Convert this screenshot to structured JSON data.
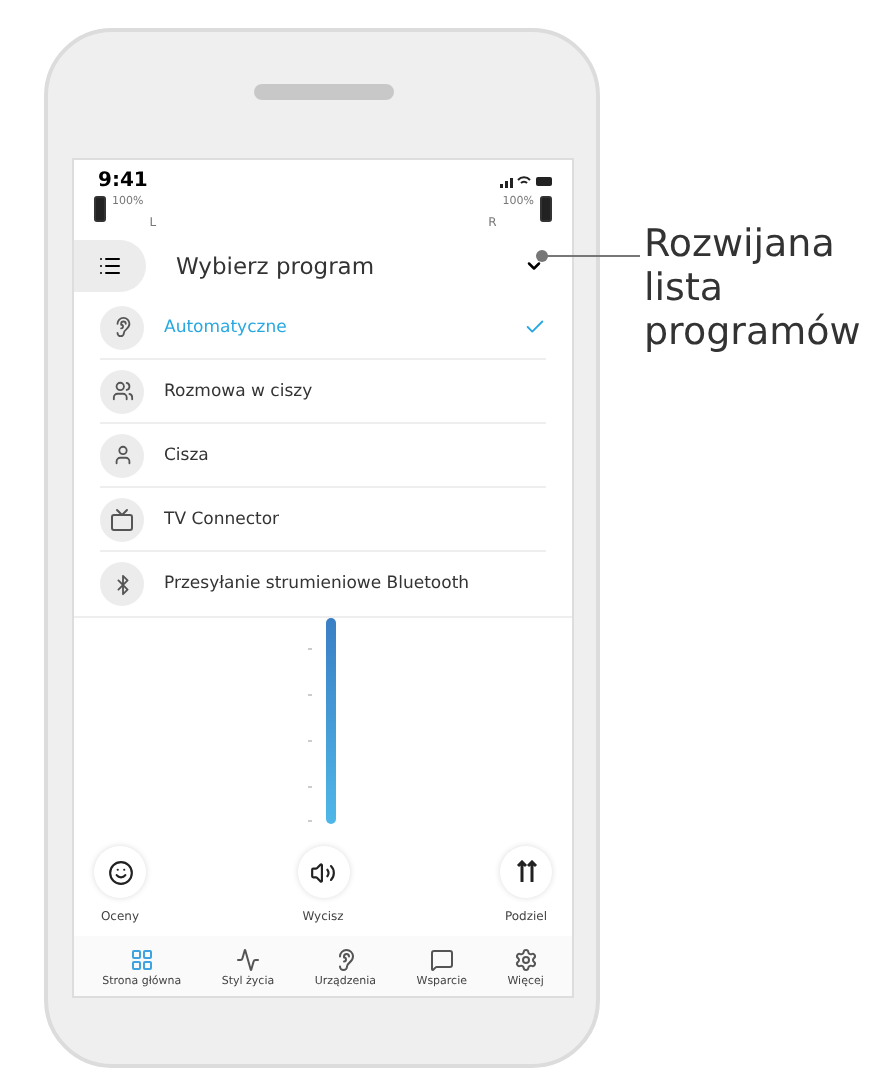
{
  "status_bar": {
    "time": "9:41"
  },
  "batteries": [
    {
      "percent": "100%",
      "side": "L"
    },
    {
      "percent": "100%",
      "side": "R"
    }
  ],
  "dropdown": {
    "title": "Wybierz program",
    "expanded": true,
    "items": [
      {
        "kind": "auto",
        "label": "Automatyczne",
        "selected": true
      },
      {
        "kind": "conversation",
        "label": "Rozmowa w ciszy",
        "selected": false
      },
      {
        "kind": "quiet",
        "label": "Cisza",
        "selected": false
      },
      {
        "kind": "tv",
        "label": "TV Connector",
        "selected": false
      },
      {
        "kind": "bluetooth",
        "label": "Przesyłanie strumieniowe Bluetooth",
        "selected": false
      }
    ]
  },
  "actions": [
    {
      "kind": "rate",
      "label": "Oceny"
    },
    {
      "kind": "mute",
      "label": "Wycisz"
    },
    {
      "kind": "split",
      "label": "Podziel"
    }
  ],
  "nav": [
    {
      "kind": "home",
      "label": "Strona główna",
      "selected": true
    },
    {
      "kind": "lifestyle",
      "label": "Styl życia",
      "selected": false
    },
    {
      "kind": "devices",
      "label": "Urządzenia",
      "selected": false
    },
    {
      "kind": "support",
      "label": "Wsparcie",
      "selected": false
    },
    {
      "kind": "more",
      "label": "Więcej",
      "selected": false
    }
  ],
  "callout": "Rozwijana lista programów"
}
